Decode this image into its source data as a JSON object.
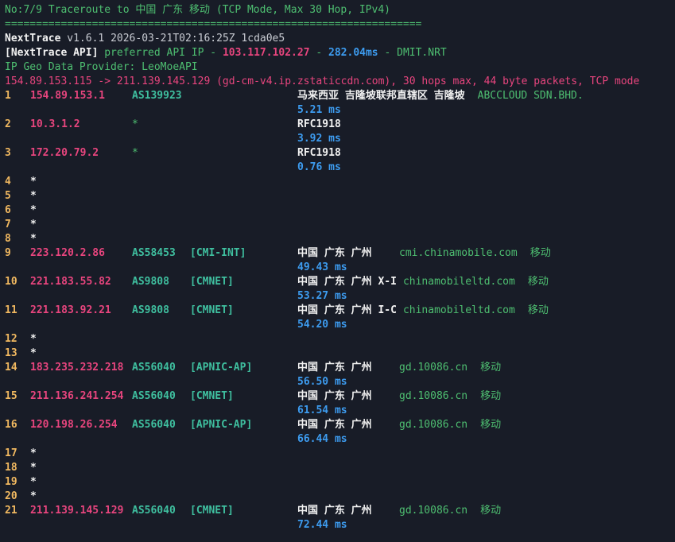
{
  "header": {
    "title": "No:7/9 Traceroute to 中国 广东 移动 (TCP Mode, Max 30 Hop, IPv4)",
    "separator": "===================================================================",
    "app_name": "NextTrace",
    "version_line": " v1.6.1 2026-03-21T02:16:25Z 1cda0e5",
    "api_label": "[NextTrace API]",
    "api_pref": " preferred API IP - ",
    "api_ip": "103.117.102.27",
    "api_dash": " - ",
    "api_latency": "282.04ms",
    "api_node": " - DMIT.NRT",
    "geo_provider": "IP Geo Data Provider: LeoMoeAPI",
    "route_summary": "154.89.153.115 -> 211.139.145.129 (gd-cm-v4.ip.zstaticcdn.com), 30 hops max, 44 byte packets, TCP mode"
  },
  "hops": [
    {
      "no": "1",
      "ip": "154.89.153.1",
      "asn": "AS139923",
      "tag": "",
      "geo": "马来西亚 吉隆坡联邦直辖区 吉隆坡",
      "domain": "",
      "isp": "ABCCLOUD SDN.BHD.",
      "rtt": "5.21 ms",
      "row": 0
    },
    {
      "no": "2",
      "ip": "10.3.1.2",
      "asn": "*",
      "tag": "",
      "geo": "RFC1918",
      "domain": "",
      "isp": "",
      "rtt": "3.92 ms",
      "row": 2
    },
    {
      "no": "3",
      "ip": "172.20.79.2",
      "asn": "*",
      "tag": "",
      "geo": "RFC1918",
      "domain": "",
      "isp": "",
      "rtt": "0.76 ms",
      "row": 4
    },
    {
      "no": "4",
      "ip": "*",
      "row": 6
    },
    {
      "no": "5",
      "ip": "*",
      "row": 7
    },
    {
      "no": "6",
      "ip": "*",
      "row": 8
    },
    {
      "no": "7",
      "ip": "*",
      "row": 9
    },
    {
      "no": "8",
      "ip": "*",
      "row": 10
    },
    {
      "no": "9",
      "ip": "223.120.2.86",
      "asn": "AS58453",
      "tag": "[CMI-INT]",
      "geo": "中国 广东 广州",
      "domain": "cmi.chinamobile.com",
      "isp": "移动",
      "rtt": "49.43 ms",
      "row": 11
    },
    {
      "no": "10",
      "ip": "221.183.55.82",
      "asn": "AS9808",
      "tag": "[CMNET]",
      "geo": "中国 广东 广州 X-I",
      "domain": "chinamobileltd.com",
      "isp": "移动",
      "rtt": "53.27 ms",
      "row": 13
    },
    {
      "no": "11",
      "ip": "221.183.92.21",
      "asn": "AS9808",
      "tag": "[CMNET]",
      "geo": "中国 广东 广州 I-C",
      "domain": "chinamobileltd.com",
      "isp": "移动",
      "rtt": "54.20 ms",
      "row": 15
    },
    {
      "no": "12",
      "ip": "*",
      "row": 17
    },
    {
      "no": "13",
      "ip": "*",
      "row": 18
    },
    {
      "no": "14",
      "ip": "183.235.232.218",
      "asn": "AS56040",
      "tag": "[APNIC-AP]",
      "geo": "中国 广东 广州",
      "domain": "gd.10086.cn",
      "isp": "移动",
      "rtt": "56.50 ms",
      "row": 19
    },
    {
      "no": "15",
      "ip": "211.136.241.254",
      "asn": "AS56040",
      "tag": "[CMNET]",
      "geo": "中国 广东 广州",
      "domain": "gd.10086.cn",
      "isp": "移动",
      "rtt": "61.54 ms",
      "row": 21
    },
    {
      "no": "16",
      "ip": "120.198.26.254",
      "asn": "AS56040",
      "tag": "[APNIC-AP]",
      "geo": "中国 广东 广州",
      "domain": "gd.10086.cn",
      "isp": "移动",
      "rtt": "66.44 ms",
      "row": 23
    },
    {
      "no": "17",
      "ip": "*",
      "row": 25
    },
    {
      "no": "18",
      "ip": "*",
      "row": 26
    },
    {
      "no": "19",
      "ip": "*",
      "row": 27
    },
    {
      "no": "20",
      "ip": "*",
      "row": 28
    },
    {
      "no": "21",
      "ip": "211.139.145.129",
      "asn": "AS56040",
      "tag": "[CMNET]",
      "geo": "中国 广东 广州",
      "domain": "gd.10086.cn",
      "isp": "移动",
      "rtt": "72.44 ms",
      "row": 29
    }
  ],
  "colors": {
    "background": "#181c27",
    "hop_number": "#f0b860",
    "ip": "#e8457e",
    "asn": "#3fbf9f",
    "geo": "#f2f2f2",
    "domain": "#4ebf71",
    "rtt": "#3d9cf0"
  }
}
